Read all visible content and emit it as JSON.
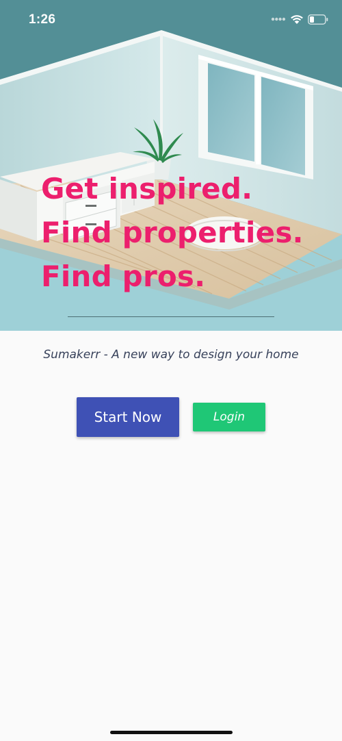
{
  "status_bar": {
    "time": "1:26",
    "signal_icon": "signal-dots-icon",
    "wifi_icon": "wifi-icon",
    "battery_icon": "battery-icon",
    "battery_level": 0.25
  },
  "hero": {
    "image": "isometric-room-illustration",
    "headline": [
      "Get inspired.",
      "Find properties.",
      "Find pros."
    ],
    "headline_color": "#ec1f6d"
  },
  "tagline": "Sumakerr - A new way to design your home",
  "actions": {
    "start_label": "Start Now",
    "start_color": "#3f51b5",
    "login_label": "Login",
    "login_color": "#1fc776"
  }
}
